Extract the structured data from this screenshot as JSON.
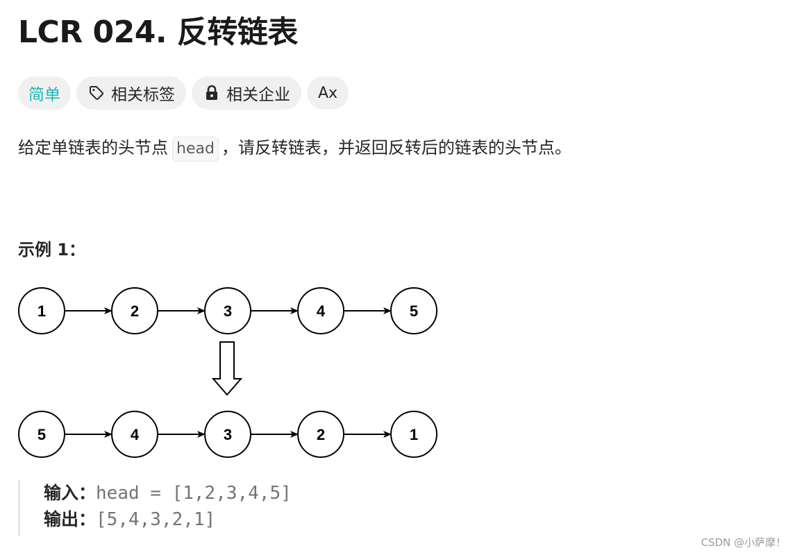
{
  "problem": {
    "title": "LCR 024. 反转链表"
  },
  "pills": {
    "difficulty": "简单",
    "difficulty_color": "#1cb8b8",
    "tags_label": "相关标签",
    "tags_icon": "tag-icon",
    "companies_label": "相关企业",
    "companies_icon": "lock-icon",
    "translate_label": "Ax",
    "translate_icon": "translate-icon"
  },
  "description": {
    "before": "给定单链表的头节点",
    "code": "head",
    "after": "，请反转链表，并返回反转后的链表的头节点。"
  },
  "example": {
    "title": "示例 1：",
    "diagram": {
      "original_list": [
        "1",
        "2",
        "3",
        "4",
        "5"
      ],
      "reversed_list": [
        "5",
        "4",
        "3",
        "2",
        "1"
      ],
      "transition_icon": "down-arrow-icon"
    },
    "input_label": "输入：",
    "input_value": "head = [1,2,3,4,5]",
    "output_label": "输出：",
    "output_value": "[5,4,3,2,1]"
  },
  "watermark": "CSDN @小萨摩！"
}
